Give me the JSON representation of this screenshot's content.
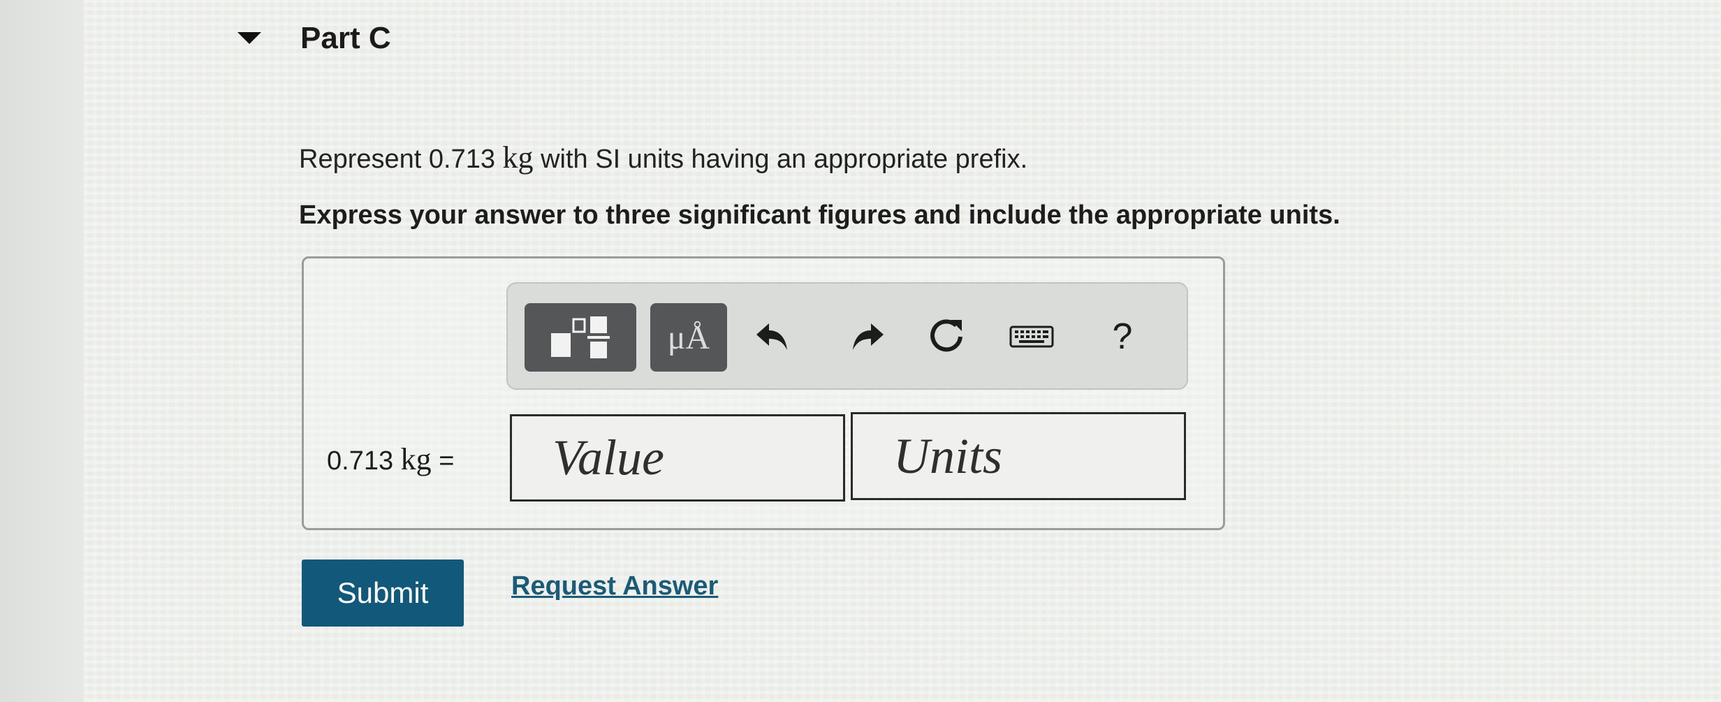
{
  "part": {
    "title": "Part C"
  },
  "question": {
    "prefix": "Represent 0.713 ",
    "unit": "kg",
    "suffix": " with SI units having an appropriate prefix.",
    "instruction": "Express your answer to three significant figures and include the appropriate units."
  },
  "toolbar": {
    "units_label": "μÅ",
    "help_label": "?",
    "icons": [
      "templates-icon",
      "undo-icon",
      "redo-icon",
      "reset-icon",
      "keyboard-icon"
    ]
  },
  "answer": {
    "quantity": "0.713",
    "unit": "kg",
    "equals": "=",
    "value_placeholder": "Value",
    "units_placeholder": "Units"
  },
  "actions": {
    "submit_label": "Submit",
    "request_label": "Request Answer"
  },
  "colors": {
    "submit_bg": "#12587a",
    "link": "#1a5b78",
    "toolbar_button": "#545657"
  }
}
